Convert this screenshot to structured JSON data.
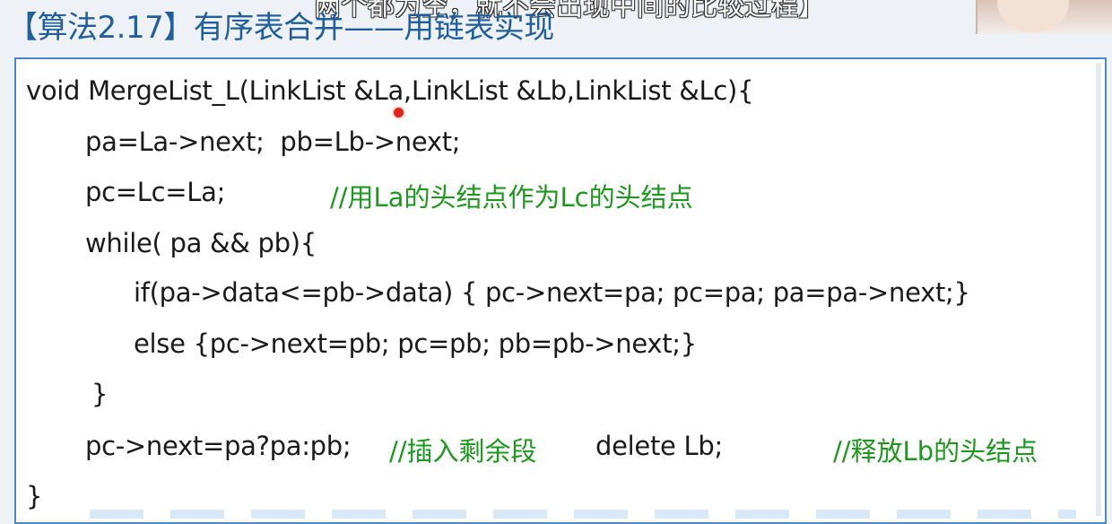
{
  "header": {
    "title": "【算法2.17】有序表合并——用链表实现",
    "caption": "两个都为空，就不会出现中间的比较过程】"
  },
  "code": {
    "l1": "void MergeList_L(LinkList &La,LinkList &Lb,LinkList &Lc){",
    "l2": "pa=La->next;  pb=Lb->next;",
    "l3": "pc=Lc=La;",
    "l3_comment": "//用La的头结点作为Lc的头结点",
    "l4": "while( pa && pb){",
    "l5": "if(pa->data<=pb->data) { pc->next=pa; pc=pa; pa=pa->next;}",
    "l6": "else {pc->next=pb; pc=pb; pb=pb->next;}",
    "l7": "}",
    "l8": "pc->next=pa?pa:pb;",
    "l8_comment": "//插入剩余段",
    "l8_delete": "delete Lb;",
    "l8_comment2": "//释放Lb的头结点",
    "l9": "}"
  },
  "colors": {
    "title": "#1f5fa0",
    "code": "#1a1a1a",
    "comment": "#1a9a1a",
    "border": "#4a88c8",
    "pointer": "#e2231a"
  }
}
